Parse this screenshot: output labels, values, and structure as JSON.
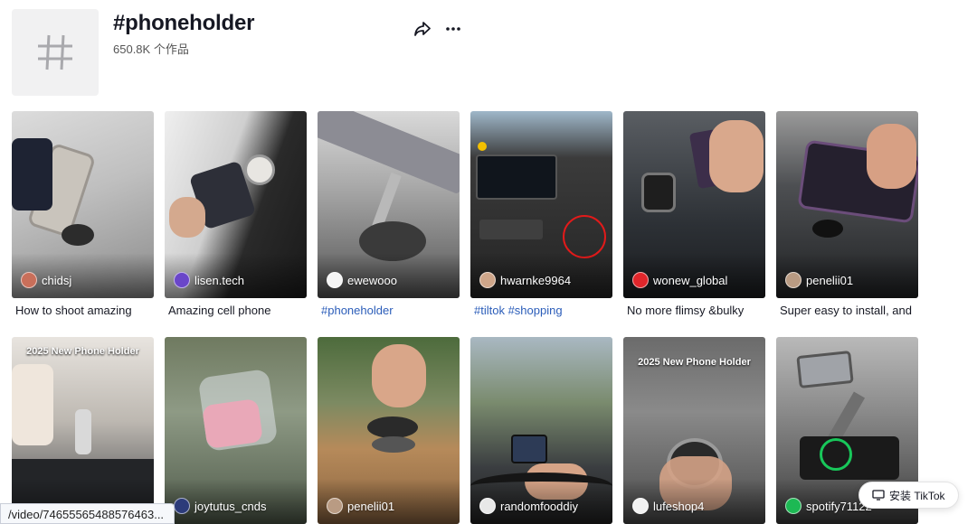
{
  "hashtag": {
    "title": "#phoneholder",
    "count": "650.8K 个作品",
    "avatar_icon": "hash-icon"
  },
  "actions": {
    "share_icon": "share-icon",
    "more_icon": "more-icon"
  },
  "videos": [
    {
      "author": "chidsj",
      "caption": "How to shoot amazing",
      "caption_link": false,
      "overlay": ""
    },
    {
      "author": "lisen.tech",
      "caption": "Amazing cell phone",
      "caption_link": false,
      "overlay": ""
    },
    {
      "author": "ewewooo",
      "caption": "#phoneholder",
      "caption_link": true,
      "overlay": ""
    },
    {
      "author": "hwarnke9964",
      "caption": "#tiltok #shopping",
      "caption_link": true,
      "overlay": ""
    },
    {
      "author": "wonew_global",
      "caption": "No more flimsy &bulky",
      "caption_link": false,
      "overlay": ""
    },
    {
      "author": "penelii01",
      "caption": "Super easy to install, and",
      "caption_link": false,
      "overlay": ""
    },
    {
      "author": "",
      "caption": "",
      "caption_link": false,
      "overlay": "2025 New Phone Holder"
    },
    {
      "author": "joytutus_cnds",
      "caption": "",
      "caption_link": false,
      "overlay": ""
    },
    {
      "author": "penelii01",
      "caption": "",
      "caption_link": false,
      "overlay": ""
    },
    {
      "author": "randomfooddiy",
      "caption": "",
      "caption_link": false,
      "overlay": ""
    },
    {
      "author": "lufeshop4",
      "caption": "",
      "caption_link": false,
      "overlay": "2025 New Phone Holder"
    },
    {
      "author": "spotify71122",
      "caption": "",
      "caption_link": false,
      "overlay": ""
    }
  ],
  "status_url": "/video/74655565488576463...",
  "install_button": "安装 TikTok",
  "colors": {
    "link": "#2b5db9",
    "text": "#161823"
  }
}
